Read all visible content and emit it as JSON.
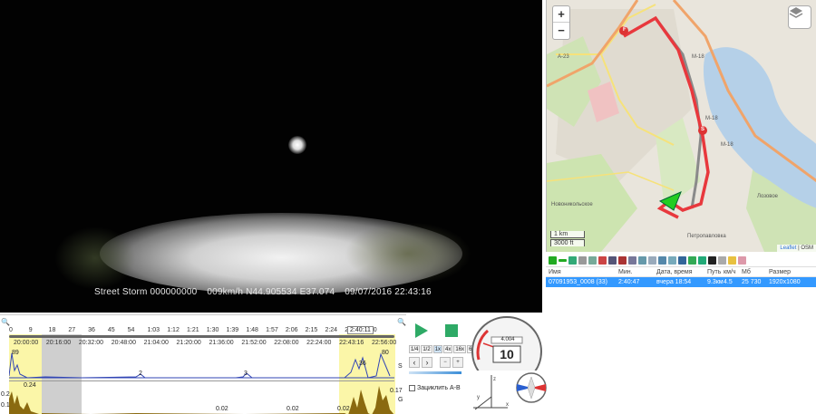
{
  "video": {
    "osd_device": "Street Storm 000000000",
    "osd_speed": "009km/h N44.905534 E37.074",
    "osd_datetime": "09/07/2016 22:43:16"
  },
  "map": {
    "zoom_in": "+",
    "zoom_out": "−",
    "scale_km": "1 km",
    "scale_ft": "3000 ft",
    "attribution_link": "Leaflet",
    "attribution_sep": " | OSM",
    "road_labels": [
      "A-23",
      "M-18",
      "M-18",
      "M-18"
    ],
    "place_labels": [
      "Новоникольское",
      "Лозовое",
      "Петропавловка"
    ],
    "marker_start": "F",
    "marker_end": "S",
    "colors": {
      "route": "#e8383d",
      "track": "#8a8a8a",
      "vehicle": "#22cc22"
    }
  },
  "file_list": {
    "headers": [
      "Имя",
      "Мин.",
      "Дата, время",
      "Путь",
      "км/ч",
      "Мб",
      "Размер"
    ],
    "rows": [
      [
        "07091953_0008 (33)",
        "2:40:47",
        "вчера 18:54",
        "9.3км",
        "4.5",
        "25 730",
        "1920x1080"
      ]
    ]
  },
  "timeline": {
    "marker_ticks": [
      "0",
      "9",
      "18",
      "27",
      "36",
      "45",
      "54",
      "1:03",
      "1:12",
      "1:21",
      "1:30",
      "1:39",
      "1:48",
      "1:57",
      "2:06",
      "2:15",
      "2:24",
      "2:33",
      "2:40"
    ],
    "time_ticks": [
      "20:00:00",
      "20:16:00",
      "20:32:00",
      "20:48:00",
      "21:04:00",
      "21:20:00",
      "21:36:00",
      "21:52:00",
      "22:08:00",
      "22:24:00",
      "22:43:16",
      "22:56:00"
    ],
    "cursor_elapsed": "2:40:11",
    "speed_axis_label": "S",
    "speed_values": [
      "89",
      "80",
      "36",
      "2",
      "3"
    ],
    "g_axis_label": "G",
    "g_values": [
      "0.24",
      "0.2",
      "0.1",
      "0.17",
      "0.02",
      "0.02",
      "0.02"
    ]
  },
  "controls": {
    "speed_options": [
      "1/4",
      "1/2",
      "1x",
      "4x",
      "16x",
      "64x"
    ],
    "ab_lock_label": "Зациклить А-В"
  },
  "gauge": {
    "speed": "10",
    "odometer": "4.004",
    "dial_labels": [
      "20",
      "40",
      "60",
      "80",
      "100",
      "120",
      "140"
    ]
  }
}
